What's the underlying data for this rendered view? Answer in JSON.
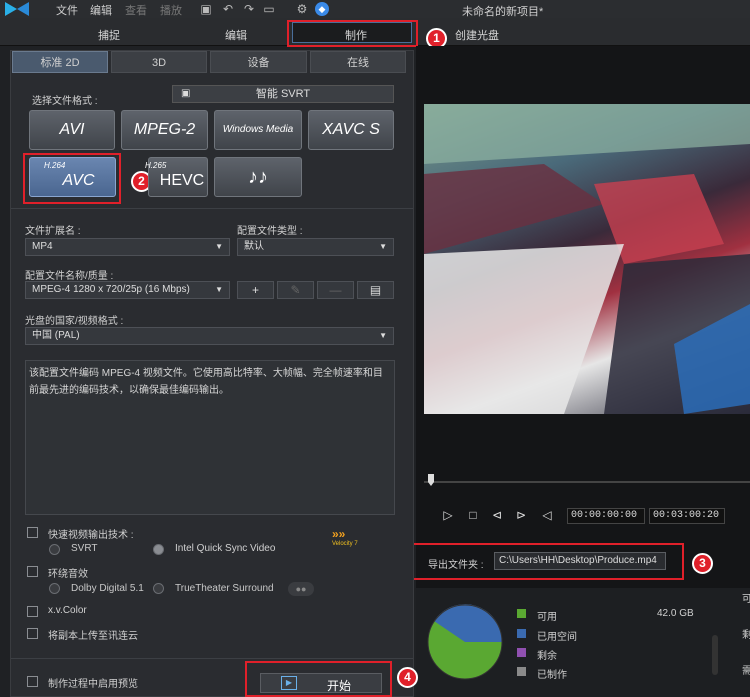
{
  "menu": {
    "file": "文件",
    "edit": "编辑",
    "view": "查看",
    "play": "播放"
  },
  "project_title": "未命名的新项目*",
  "modes": {
    "capture": "捕捉",
    "edit": "编辑",
    "produce": "制作",
    "disc": "创建光盘"
  },
  "subtabs": {
    "std2d": "标准 2D",
    "3d": "3D",
    "device": "设备",
    "online": "在线"
  },
  "format_label": "选择文件格式 :",
  "svrt_button": "智能 SVRT",
  "formats": {
    "avi": "AVI",
    "mpeg2": "MPEG-2",
    "wmv": "Windows Media",
    "xavc": "XAVC S",
    "h264_small": "H.264",
    "h264": "AVC",
    "hevc_small": "H.265",
    "hevc": "HEVC",
    "audio": "♪♪"
  },
  "ext_label": "文件扩展名 :",
  "ext_value": "MP4",
  "profile_type_label": "配置文件类型 :",
  "profile_type_value": "默认",
  "profile_name_label": "配置文件名称/质量 :",
  "profile_name_value": "MPEG-4 1280 x 720/25p (16 Mbps)",
  "region_label": "光盘的国家/视频格式 :",
  "region_value": "中国 (PAL)",
  "description": "该配置文件编码 MPEG-4 视频文件。它使用高比特率、大帧幅、完全帧速率和目前最先进的编码技术，以确保最佳编码输出。",
  "options": {
    "fast_render": "快速视频输出技术 :",
    "svrt": "SVRT",
    "intel": "Intel Quick Sync Video",
    "surround": "环绕音效",
    "dolby": "Dolby Digital 5.1",
    "truetheater": "TrueTheater Surround",
    "xvcolor": "x.v.Color",
    "upload": "将副本上传至讯连云",
    "preview": "制作过程中启用预览",
    "velocity": "Velocity 7"
  },
  "start_button": "开始",
  "timecode_current": "00:00:00:00",
  "timecode_total": "00:03:00:20",
  "export_label": "导出文件夹 :",
  "export_path": "C:\\Users\\HH\\Desktop\\Produce.mp4",
  "disk": {
    "available_label": "可用",
    "available_value": "42.0  GB",
    "used_label": "已用空间",
    "remaining_label": "剩余",
    "produced_label": "已制作",
    "right_1": "可",
    "right_2": "剩",
    "right_3": "需"
  },
  "badges": [
    "1",
    "2",
    "3",
    "4"
  ],
  "colors": {
    "green": "#5aa832",
    "blue": "#3a6ab0",
    "purple": "#9050b0",
    "gray": "#8a8a8a",
    "red_frame": "#e0202a"
  }
}
